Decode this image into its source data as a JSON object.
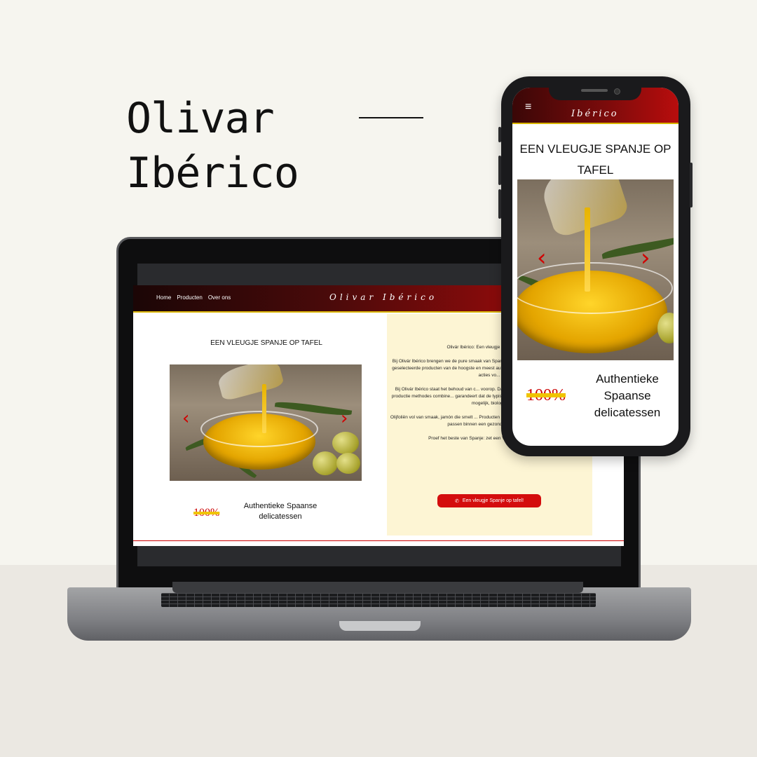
{
  "brand": {
    "title_line1": "Olivar",
    "title_line2": "Ibérico"
  },
  "desktop": {
    "nav": [
      "Home",
      "Producten",
      "Over ons"
    ],
    "logo": "Olivar Ibérico",
    "heading": "EEN VLEUGJE SPANJE OP TAFEL",
    "stat": "100%",
    "stat_label": "Authentieke Spaanse delicatessen",
    "paragraphs": [
      "Olivár Ibérico: Een vleugje Spanje op tafel",
      "Bij Olivár Ibérico brengen we de pure smaak van Spanje. Ons assortiment bestaat uit zorgvuldig geselecteerde producten van de hoogste en meest authentieke kwaliteit. Wij ... soms hebben we acties vo...",
      "Bij Olivár Ibérico staat het behoud van c... voorop. Daarom werken wij samen m... traditionele productie methodes combine... garandeert dat de typische smaken behoud... duurzaam en, waar mogelijk, biolog...",
      "Olijfoliën vol van smaak, jamón die smelt ... Producten die perfect zijn voor het serveren van ... die passen binnen een gezondere levensstijl.",
      "Proef het beste van Spanje: zet een Vleugje Spanje op tafel!"
    ],
    "cta": "Een vleugje Spanje op tafel!",
    "cta_icon": "phone-icon"
  },
  "mobile": {
    "menu_icon": "≡",
    "logo": "Ibérico",
    "heading": "EEN VLEUGJE SPANJE OP TAFEL",
    "stat": "100%",
    "stat_label": "Authentieke Spaanse delicatessen"
  },
  "carousel": {
    "prev": "‹",
    "next": "›"
  },
  "colors": {
    "accent_red": "#d40d0d",
    "gold": "#d9b400",
    "cream": "#fdf5d4",
    "nav_dark": "#1b0606"
  }
}
